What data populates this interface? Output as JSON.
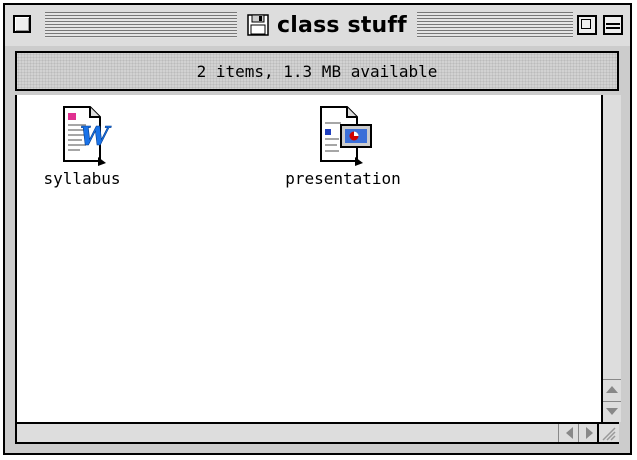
{
  "window": {
    "title": "class stuff",
    "info": "2 items, 1.3 MB available"
  },
  "icons": {
    "close": "close-box-icon",
    "zoom": "zoom-box-icon",
    "collapse": "windowshade-icon",
    "title": "floppy-disk-icon",
    "grow": "resize-grip-icon"
  },
  "files": [
    {
      "name": "syllabus",
      "icon": "word-document-icon"
    },
    {
      "name": "presentation",
      "icon": "presentation-document-icon"
    }
  ],
  "colors": {
    "window_bg": "#cccccc",
    "content_bg": "#ffffff",
    "word_blue": "#1a73e8",
    "chart_red": "#d00000"
  }
}
